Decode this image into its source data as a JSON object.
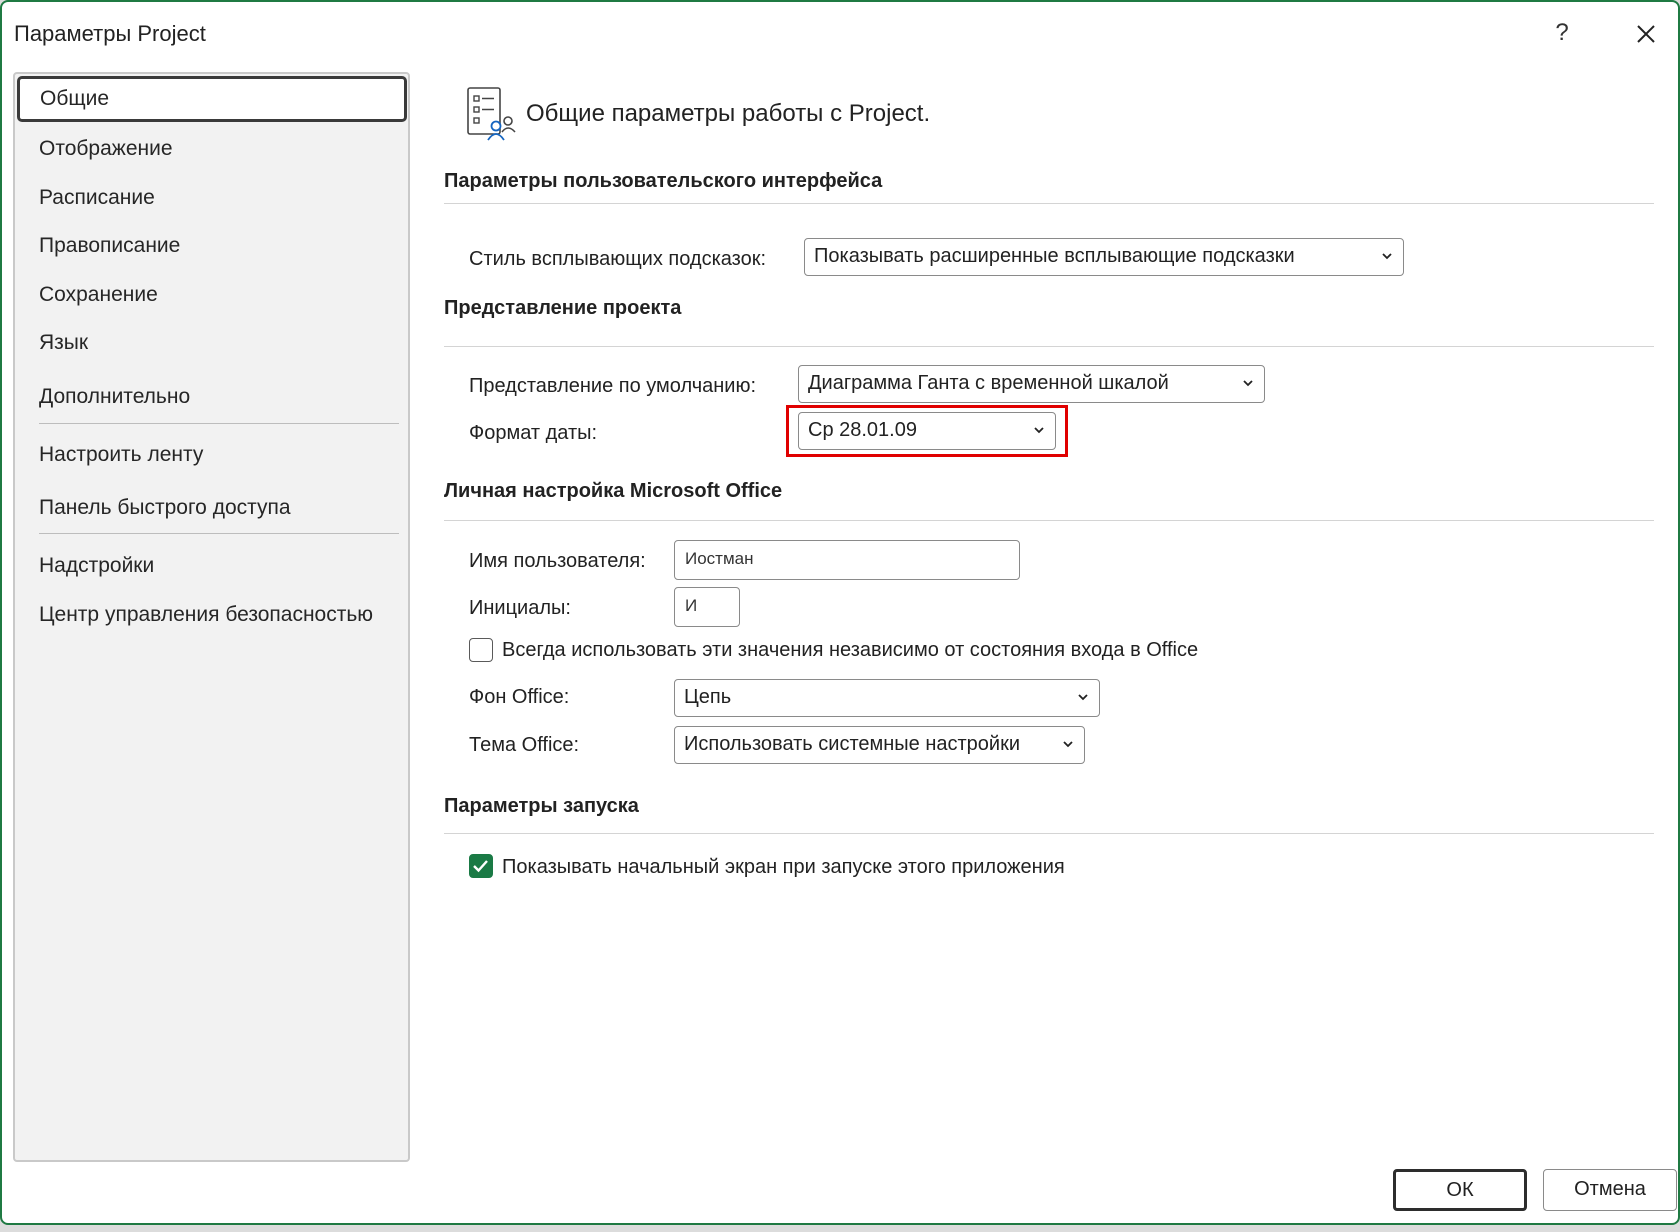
{
  "window": {
    "title": "Параметры Project",
    "help_label": "?"
  },
  "sidebar": {
    "items": [
      {
        "label": "Общие"
      },
      {
        "label": "Отображение"
      },
      {
        "label": "Расписание"
      },
      {
        "label": "Правописание"
      },
      {
        "label": "Сохранение"
      },
      {
        "label": "Язык"
      },
      {
        "label": "Дополнительно"
      },
      {
        "label": "Настроить ленту"
      },
      {
        "label": "Панель быстрого доступа"
      },
      {
        "label": "Надстройки"
      },
      {
        "label": "Центр управления безопасностью"
      }
    ]
  },
  "main": {
    "header": "Общие параметры работы с Project.",
    "ui_section": {
      "title": "Параметры пользовательского интерфейса",
      "tooltip_label": "Стиль всплывающих подсказок:",
      "tooltip_value": "Показывать расширенные всплывающие подсказки"
    },
    "project_section": {
      "title": "Представление проекта",
      "default_view_label": "Представление по умолчанию:",
      "default_view_value": "Диаграмма Ганта с временной шкалой",
      "date_format_label": "Формат даты:",
      "date_format_value": "Ср 28.01.09"
    },
    "office_section": {
      "title": "Личная настройка Microsoft Office",
      "username_label": "Имя пользователя:",
      "username_value": "Иостман",
      "initials_label": "Инициалы:",
      "initials_value": "И",
      "always_use_label": "Всегда использовать эти значения независимо от состояния входа в Office",
      "always_use_checked": false,
      "background_label": "Фон Office:",
      "background_value": "Цепь",
      "theme_label": "Тема Office:",
      "theme_value": "Использовать системные настройки"
    },
    "startup_section": {
      "title": "Параметры запуска",
      "show_start_label": "Показывать начальный экран при запуске этого приложения",
      "show_start_checked": true
    }
  },
  "footer": {
    "ok_label": "ОК",
    "cancel_label": "Отмена"
  },
  "colors": {
    "accent": "#1a7a45",
    "highlight": "#e00000"
  }
}
